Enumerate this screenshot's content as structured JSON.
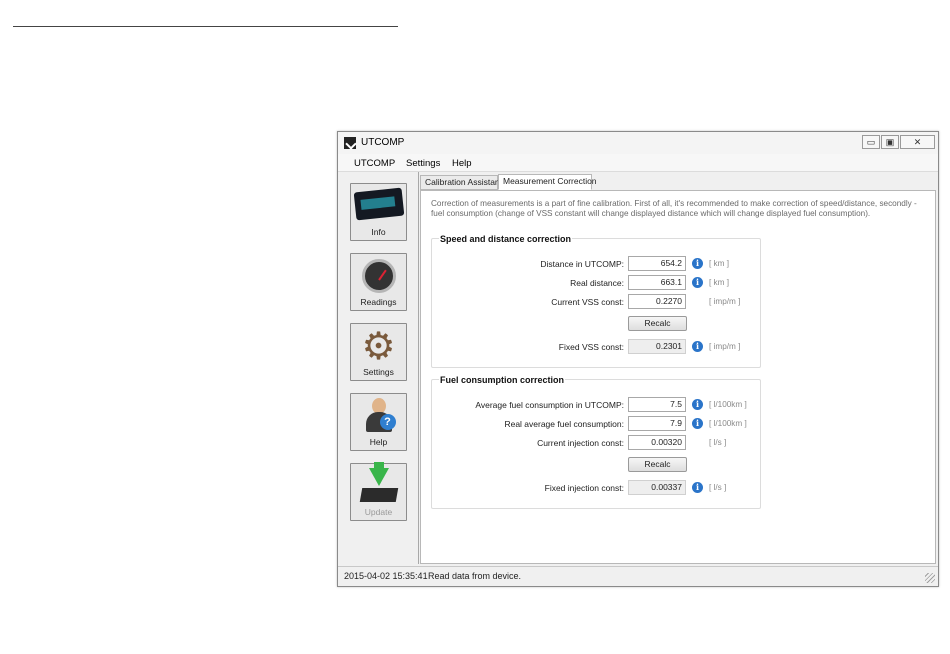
{
  "window": {
    "title": "UTCOMP",
    "controls": {
      "minimize": "▭",
      "maximize": "▣",
      "close": "✕"
    }
  },
  "menu": [
    "UTCOMP",
    "Settings",
    "Help"
  ],
  "sidebar": {
    "items": [
      {
        "label": "Info",
        "icon": "display-icon"
      },
      {
        "label": "Readings",
        "icon": "gauge-icon"
      },
      {
        "label": "Settings",
        "icon": "gear-icon"
      },
      {
        "label": "Help",
        "icon": "help-person-icon"
      },
      {
        "label": "Update",
        "icon": "download-icon",
        "disabled": true
      }
    ]
  },
  "tabs": [
    "Calibration Assistant",
    "Measurement Correction"
  ],
  "intro": "Correction of measurements is a part of fine calibration. First of all, it's recommended to make correction of speed/distance, secondly - fuel consumption (change of VSS constant will change displayed distance which will change displayed fuel consumption).",
  "speed": {
    "title": "Speed and distance correction",
    "distance_label": "Distance in UTCOMP:",
    "distance_value": "654.2",
    "distance_unit": "[ km ]",
    "real_label": "Real distance:",
    "real_value": "663.1",
    "real_unit": "[ km ]",
    "vss_label": "Current VSS const:",
    "vss_value": "0.2270",
    "vss_unit": "[ imp/m ]",
    "recalc": "Recalc",
    "fixed_label": "Fixed VSS const:",
    "fixed_value": "0.2301",
    "fixed_unit": "[ imp/m ]"
  },
  "fuel": {
    "title": "Fuel consumption correction",
    "avg_label": "Average fuel consumption in UTCOMP:",
    "avg_value": "7.5",
    "avg_unit": "[ l/100km ]",
    "real_label": "Real average fuel consumption:",
    "real_value": "7.9",
    "real_unit": "[ l/100km ]",
    "inj_label": "Current injection const:",
    "inj_value": "0.00320",
    "inj_unit": "[ l/s ]",
    "recalc": "Recalc",
    "fixed_label": "Fixed injection const:",
    "fixed_value": "0.00337",
    "fixed_unit": "[ l/s ]"
  },
  "status": {
    "time": "2015-04-02 15:35:41",
    "message": "Read data from device."
  }
}
